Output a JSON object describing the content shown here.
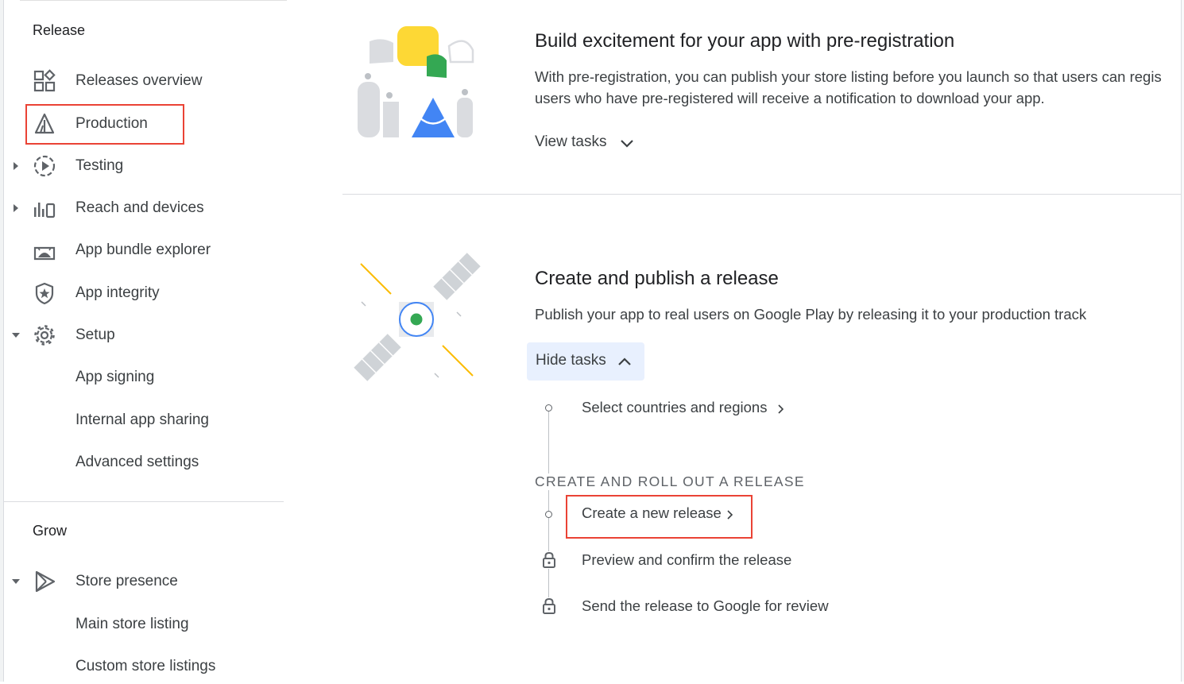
{
  "sidebar": {
    "release_section": "Release",
    "grow_section": "Grow",
    "items": {
      "releases_overview": "Releases overview",
      "production": "Production",
      "testing": "Testing",
      "reach_and_devices": "Reach and devices",
      "app_bundle_explorer": "App bundle explorer",
      "app_integrity": "App integrity",
      "setup": "Setup",
      "app_signing": "App signing",
      "internal_app_sharing": "Internal app sharing",
      "advanced_settings": "Advanced settings",
      "store_presence": "Store presence",
      "main_store_listing": "Main store listing",
      "custom_store_listings": "Custom store listings"
    }
  },
  "preregistration": {
    "title": "Build excitement for your app with pre-registration",
    "desc_line1": "With pre-registration, you can publish your store listing before you launch so that users can regis",
    "desc_line2": "users who have pre-registered will receive a notification to download your app.",
    "view_tasks": "View tasks"
  },
  "publish": {
    "title": "Create and publish a release",
    "desc": "Publish your app to real users on Google Play by releasing it to your production track",
    "hide_tasks": "Hide tasks",
    "task_countries": "Select countries and regions",
    "group_heading": "CREATE AND ROLL OUT A RELEASE",
    "task_new_release": "Create a new release",
    "task_preview": "Preview and confirm the release",
    "task_send": "Send the release to Google for review"
  },
  "colors": {
    "highlight_border": "#ea4335",
    "button_bg": "#e8f0fe",
    "accent_blue": "#4285f4",
    "accent_green": "#34a853",
    "accent_yellow": "#fbbc04"
  }
}
